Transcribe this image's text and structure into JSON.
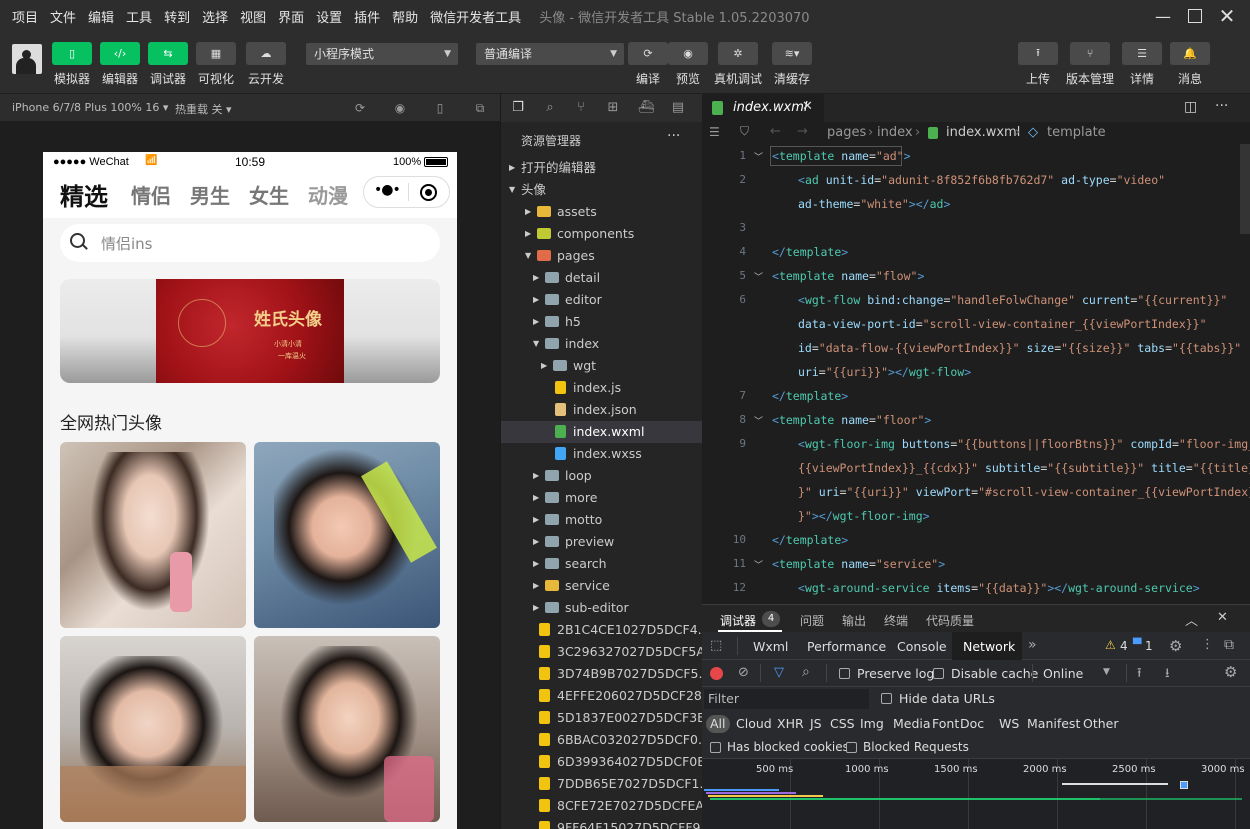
{
  "menubar": {
    "items": [
      "项目",
      "文件",
      "编辑",
      "工具",
      "转到",
      "选择",
      "视图",
      "界面",
      "设置",
      "插件",
      "帮助",
      "微信开发者工具"
    ],
    "window_title": "头像 - 微信开发者工具 Stable 1.05.2203070"
  },
  "toolbar": {
    "left_buttons": [
      {
        "label": "模拟器",
        "icon": "phone-icon"
      },
      {
        "label": "编辑器",
        "icon": "code-icon"
      },
      {
        "label": "调试器",
        "icon": "debug-icon"
      },
      {
        "label": "可视化",
        "icon": "layout-icon"
      },
      {
        "label": "云开发",
        "icon": "cloud-icon"
      }
    ],
    "mode_select": "小程序模式",
    "compile_select": "普通编译",
    "mid_buttons": [
      {
        "label": "编译",
        "icon": "refresh-icon"
      },
      {
        "label": "预览",
        "icon": "eye-icon"
      },
      {
        "label": "真机调试",
        "icon": "bug-icon"
      },
      {
        "label": "清缓存",
        "icon": "layers-icon"
      }
    ],
    "right_buttons": [
      {
        "label": "上传",
        "icon": "upload-icon"
      },
      {
        "label": "版本管理",
        "icon": "branch-icon"
      },
      {
        "label": "详情",
        "icon": "menu-icon"
      },
      {
        "label": "消息",
        "icon": "bell-icon"
      }
    ]
  },
  "simbar": {
    "device": "iPhone 6/7/8 Plus 100% 16",
    "hotreload": "热重载 关"
  },
  "phone": {
    "status": {
      "carrier": "●●●●● WeChat",
      "time": "10:59",
      "battery": "100%"
    },
    "categories": [
      "精选",
      "情侣",
      "男生",
      "女生",
      "动漫"
    ],
    "search_placeholder": "情侣ins",
    "banner_title": "姓氏头像",
    "banner_sub1": "小清小清",
    "banner_sub2": "一库温火",
    "section_title": "全网热门头像"
  },
  "explorer": {
    "title": "资源管理器",
    "open_editors": "打开的编辑器",
    "project": "头像",
    "tree": [
      {
        "label": "assets",
        "depth": 1,
        "kind": "folder-special",
        "color": "#e8b83a",
        "expanded": false
      },
      {
        "label": "components",
        "depth": 1,
        "kind": "folder-special",
        "color": "#c0ca33",
        "expanded": false
      },
      {
        "label": "pages",
        "depth": 1,
        "kind": "folder-special",
        "color": "#e06c4a",
        "expanded": true
      },
      {
        "label": "detail",
        "depth": 2,
        "kind": "folder",
        "color": "#90a4ae",
        "expanded": false
      },
      {
        "label": "editor",
        "depth": 2,
        "kind": "folder",
        "color": "#90a4ae",
        "expanded": false
      },
      {
        "label": "h5",
        "depth": 2,
        "kind": "folder",
        "color": "#90a4ae",
        "expanded": false
      },
      {
        "label": "index",
        "depth": 2,
        "kind": "folder",
        "color": "#90a4ae",
        "expanded": true
      },
      {
        "label": "wgt",
        "depth": 3,
        "kind": "folder",
        "color": "#90a4ae",
        "expanded": false
      },
      {
        "label": "index.js",
        "depth": 3,
        "kind": "js",
        "color": "#f1c40f"
      },
      {
        "label": "index.json",
        "depth": 3,
        "kind": "json",
        "color": "#e5c07b"
      },
      {
        "label": "index.wxml",
        "depth": 3,
        "kind": "wxml",
        "color": "#4caf50",
        "selected": true
      },
      {
        "label": "index.wxss",
        "depth": 3,
        "kind": "wxss",
        "color": "#42a5f5"
      },
      {
        "label": "loop",
        "depth": 2,
        "kind": "folder",
        "color": "#90a4ae",
        "expanded": false
      },
      {
        "label": "more",
        "depth": 2,
        "kind": "folder",
        "color": "#90a4ae",
        "expanded": false
      },
      {
        "label": "motto",
        "depth": 2,
        "kind": "folder",
        "color": "#90a4ae",
        "expanded": false
      },
      {
        "label": "preview",
        "depth": 2,
        "kind": "folder",
        "color": "#90a4ae",
        "expanded": false
      },
      {
        "label": "search",
        "depth": 2,
        "kind": "folder",
        "color": "#90a4ae",
        "expanded": false
      },
      {
        "label": "service",
        "depth": 2,
        "kind": "folder-special",
        "color": "#e8b83a",
        "expanded": false
      },
      {
        "label": "sub-editor",
        "depth": 2,
        "kind": "folder",
        "color": "#90a4ae",
        "expanded": false
      },
      {
        "label": "2B1C4CE1027D5DCF4...",
        "depth": 1,
        "kind": "js",
        "color": "#f1c40f"
      },
      {
        "label": "3C296327027D5DCF5A...",
        "depth": 1,
        "kind": "js",
        "color": "#f1c40f"
      },
      {
        "label": "3D74B9B7027D5DCF5...",
        "depth": 1,
        "kind": "js",
        "color": "#f1c40f"
      },
      {
        "label": "4EFFE206027D5DCF28...",
        "depth": 1,
        "kind": "js",
        "color": "#f1c40f"
      },
      {
        "label": "5D1837E0027D5DCF3B...",
        "depth": 1,
        "kind": "js",
        "color": "#f1c40f"
      },
      {
        "label": "6BBAC032027D5DCF0...",
        "depth": 1,
        "kind": "js",
        "color": "#f1c40f"
      },
      {
        "label": "6D399364027D5DCF0B...",
        "depth": 1,
        "kind": "js",
        "color": "#f1c40f"
      },
      {
        "label": "7DDB65E7027D5DCF1...",
        "depth": 1,
        "kind": "js",
        "color": "#f1c40f"
      },
      {
        "label": "8CFE72E7027D5DCFEA...",
        "depth": 1,
        "kind": "js",
        "color": "#f1c40f"
      },
      {
        "label": "9FF64F15027D5DCFF9...",
        "depth": 1,
        "kind": "js",
        "color": "#f1c40f"
      }
    ]
  },
  "editor": {
    "tab": "index.wxml",
    "breadcrumbs": [
      "pages",
      "index",
      "index.wxml",
      "template"
    ],
    "lines": [
      {
        "n": "1",
        "fold": true,
        "indent": 0,
        "tokens": [
          [
            "tg2",
            "<"
          ],
          [
            "tg",
            "template"
          ],
          [
            "eq",
            " "
          ],
          [
            "at",
            "name"
          ],
          [
            "eq",
            "="
          ],
          [
            "st",
            "\"ad\""
          ],
          [
            "tg2",
            ">"
          ]
        ]
      },
      {
        "n": "2",
        "fold": false,
        "indent": 1,
        "tokens": [
          [
            "tg2",
            "<"
          ],
          [
            "tg",
            "ad"
          ],
          [
            "eq",
            " "
          ],
          [
            "at",
            "unit-id"
          ],
          [
            "eq",
            "="
          ],
          [
            "st",
            "\"adunit-8f852f6b8fb762d7\""
          ],
          [
            "eq",
            " "
          ],
          [
            "at",
            "ad-type"
          ],
          [
            "eq",
            "="
          ],
          [
            "st",
            "\"video\""
          ]
        ]
      },
      {
        "n": "",
        "fold": false,
        "indent": 1,
        "tokens": [
          [
            "at",
            "ad-theme"
          ],
          [
            "eq",
            "="
          ],
          [
            "st",
            "\"white\""
          ],
          [
            "tg2",
            "></"
          ],
          [
            "tg",
            "ad"
          ],
          [
            "tg2",
            ">"
          ]
        ]
      },
      {
        "n": "3",
        "fold": false,
        "indent": 0,
        "tokens": []
      },
      {
        "n": "4",
        "fold": false,
        "indent": 0,
        "tokens": [
          [
            "tg2",
            "</"
          ],
          [
            "tg",
            "template"
          ],
          [
            "tg2",
            ">"
          ]
        ]
      },
      {
        "n": "5",
        "fold": true,
        "indent": 0,
        "tokens": [
          [
            "tg2",
            "<"
          ],
          [
            "tg",
            "template"
          ],
          [
            "eq",
            " "
          ],
          [
            "at",
            "name"
          ],
          [
            "eq",
            "="
          ],
          [
            "st",
            "\"flow\""
          ],
          [
            "tg2",
            ">"
          ]
        ]
      },
      {
        "n": "6",
        "fold": false,
        "indent": 1,
        "tokens": [
          [
            "tg2",
            "<"
          ],
          [
            "tg",
            "wgt-flow"
          ],
          [
            "eq",
            " "
          ],
          [
            "at",
            "bind:change"
          ],
          [
            "eq",
            "="
          ],
          [
            "st",
            "\"handleFolwChange\""
          ],
          [
            "eq",
            " "
          ],
          [
            "at",
            "current"
          ],
          [
            "eq",
            "="
          ],
          [
            "st",
            "\"{{current}}\""
          ]
        ]
      },
      {
        "n": "",
        "fold": false,
        "indent": 1,
        "tokens": [
          [
            "at",
            "data-view-port-id"
          ],
          [
            "eq",
            "="
          ],
          [
            "st",
            "\"scroll-view-container_{{viewPortIndex}}\""
          ]
        ]
      },
      {
        "n": "",
        "fold": false,
        "indent": 1,
        "tokens": [
          [
            "at",
            "id"
          ],
          [
            "eq",
            "="
          ],
          [
            "st",
            "\"data-flow-{{viewPortIndex}}\""
          ],
          [
            "eq",
            " "
          ],
          [
            "at",
            "size"
          ],
          [
            "eq",
            "="
          ],
          [
            "st",
            "\"{{size}}\""
          ],
          [
            "eq",
            " "
          ],
          [
            "at",
            "tabs"
          ],
          [
            "eq",
            "="
          ],
          [
            "st",
            "\"{{tabs}}\""
          ]
        ]
      },
      {
        "n": "",
        "fold": false,
        "indent": 1,
        "tokens": [
          [
            "at",
            "uri"
          ],
          [
            "eq",
            "="
          ],
          [
            "st",
            "\"{{uri}}\""
          ],
          [
            "tg2",
            "></"
          ],
          [
            "tg",
            "wgt-flow"
          ],
          [
            "tg2",
            ">"
          ]
        ]
      },
      {
        "n": "7",
        "fold": false,
        "indent": 0,
        "tokens": [
          [
            "tg2",
            "</"
          ],
          [
            "tg",
            "template"
          ],
          [
            "tg2",
            ">"
          ]
        ]
      },
      {
        "n": "8",
        "fold": true,
        "indent": 0,
        "tokens": [
          [
            "tg2",
            "<"
          ],
          [
            "tg",
            "template"
          ],
          [
            "eq",
            " "
          ],
          [
            "at",
            "name"
          ],
          [
            "eq",
            "="
          ],
          [
            "st",
            "\"floor\""
          ],
          [
            "tg2",
            ">"
          ]
        ]
      },
      {
        "n": "9",
        "fold": false,
        "indent": 1,
        "tokens": [
          [
            "tg2",
            "<"
          ],
          [
            "tg",
            "wgt-floor-img"
          ],
          [
            "eq",
            " "
          ],
          [
            "at",
            "buttons"
          ],
          [
            "eq",
            "="
          ],
          [
            "st",
            "\"{{buttons||floorBtns}}\""
          ],
          [
            "eq",
            " "
          ],
          [
            "at",
            "compId"
          ],
          [
            "eq",
            "="
          ],
          [
            "st",
            "\"floor-img_"
          ]
        ]
      },
      {
        "n": "",
        "fold": false,
        "indent": 1,
        "tokens": [
          [
            "st",
            "{{viewPortIndex}}_{{cdx}}\""
          ],
          [
            "eq",
            " "
          ],
          [
            "at",
            "subtitle"
          ],
          [
            "eq",
            "="
          ],
          [
            "st",
            "\"{{subtitle}}\""
          ],
          [
            "eq",
            " "
          ],
          [
            "at",
            "title"
          ],
          [
            "eq",
            "="
          ],
          [
            "st",
            "\"{{title}"
          ]
        ]
      },
      {
        "n": "",
        "fold": false,
        "indent": 1,
        "tokens": [
          [
            "st",
            "}\""
          ],
          [
            "eq",
            " "
          ],
          [
            "at",
            "uri"
          ],
          [
            "eq",
            "="
          ],
          [
            "st",
            "\"{{uri}}\""
          ],
          [
            "eq",
            " "
          ],
          [
            "at",
            "viewPort"
          ],
          [
            "eq",
            "="
          ],
          [
            "st",
            "\"#scroll-view-container_{{viewPortIndex}"
          ]
        ]
      },
      {
        "n": "",
        "fold": false,
        "indent": 1,
        "tokens": [
          [
            "st",
            "}\""
          ],
          [
            "tg2",
            "></"
          ],
          [
            "tg",
            "wgt-floor-img"
          ],
          [
            "tg2",
            ">"
          ]
        ]
      },
      {
        "n": "10",
        "fold": false,
        "indent": 0,
        "tokens": [
          [
            "tg2",
            "</"
          ],
          [
            "tg",
            "template"
          ],
          [
            "tg2",
            ">"
          ]
        ]
      },
      {
        "n": "11",
        "fold": true,
        "indent": 0,
        "tokens": [
          [
            "tg2",
            "<"
          ],
          [
            "tg",
            "template"
          ],
          [
            "eq",
            " "
          ],
          [
            "at",
            "name"
          ],
          [
            "eq",
            "="
          ],
          [
            "st",
            "\"service\""
          ],
          [
            "tg2",
            ">"
          ]
        ]
      },
      {
        "n": "12",
        "fold": false,
        "indent": 1,
        "tokens": [
          [
            "tg2",
            "<"
          ],
          [
            "tg",
            "wgt-around-service"
          ],
          [
            "eq",
            " "
          ],
          [
            "at",
            "items"
          ],
          [
            "eq",
            "="
          ],
          [
            "st",
            "\"{{data}}\""
          ],
          [
            "tg2",
            "></"
          ],
          [
            "tg",
            "wgt-around-service"
          ],
          [
            "tg2",
            ">"
          ]
        ]
      }
    ]
  },
  "devtools": {
    "tabs": [
      "调试器",
      "问题",
      "输出",
      "终端",
      "代码质量"
    ],
    "debugger_badge": "4",
    "panels": [
      "Wxml",
      "Performance",
      "Console",
      "Network"
    ],
    "active_panel": "Network",
    "warn_count": "4",
    "msg_count": "1",
    "preserve_log": "Preserve log",
    "disable_cache": "Disable cache",
    "throttle": "Online",
    "filter_placeholder": "Filter",
    "hide_data_urls": "Hide data URLs",
    "types": [
      "All",
      "Cloud",
      "XHR",
      "JS",
      "CSS",
      "Img",
      "Media",
      "Font",
      "Doc",
      "WS",
      "Manifest",
      "Other"
    ],
    "blocked_cookies": "Has blocked cookies",
    "blocked_requests": "Blocked Requests",
    "timeline_ticks": [
      "500 ms",
      "1000 ms",
      "1500 ms",
      "2000 ms",
      "2500 ms",
      "3000 ms"
    ]
  },
  "colors": {
    "accent_green": "#07c160",
    "network_active_bg": "#1e1e1e"
  }
}
